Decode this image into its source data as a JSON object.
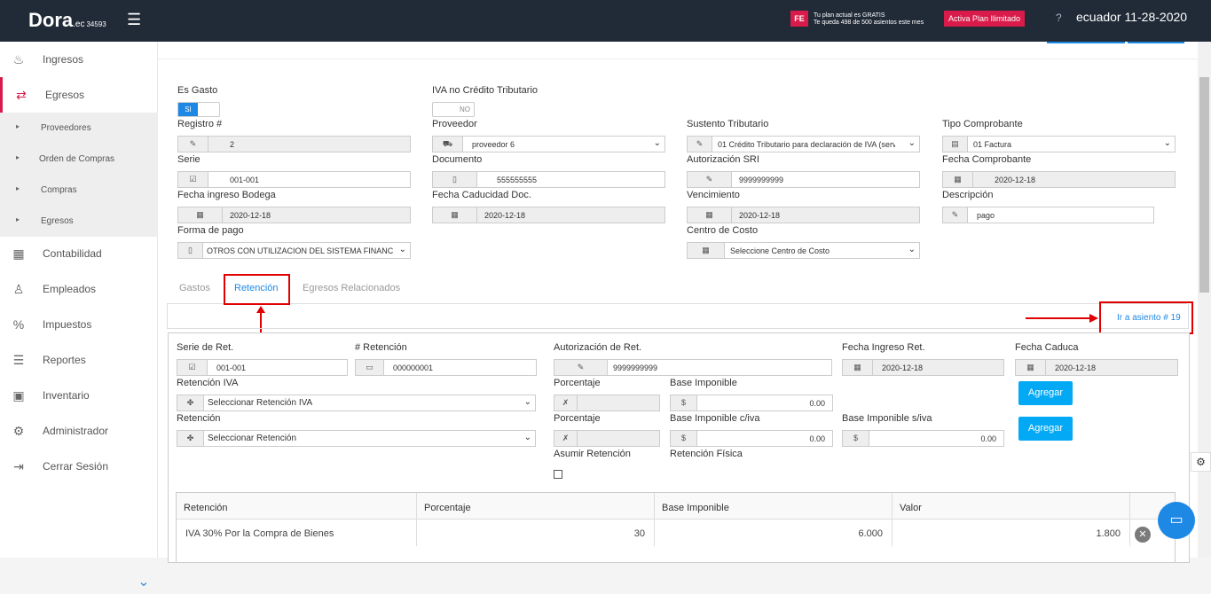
{
  "topbar": {
    "logo": "Dora",
    "logo_ec": ".ec",
    "logo_num": "34593",
    "fe": "FE",
    "plan_line1": "Tu plan actual es GRATIS",
    "plan_line2": "Te queda 498 de 500 asientos este mes",
    "activa": "Activa Plan Ilimitado",
    "user_date": "ecuador 11-28-2020"
  },
  "sidebar": {
    "items": [
      {
        "label": "Ingresos",
        "icon": "piggy-icon"
      },
      {
        "label": "Egresos",
        "icon": "money-out-icon"
      },
      {
        "label": "Contabilidad",
        "icon": "calculator-icon"
      },
      {
        "label": "Empleados",
        "icon": "people-icon"
      },
      {
        "label": "Impuestos",
        "icon": "tax-icon"
      },
      {
        "label": "Reportes",
        "icon": "report-icon"
      },
      {
        "label": "Inventario",
        "icon": "boxes-icon"
      },
      {
        "label": "Administrador",
        "icon": "gear-icon"
      },
      {
        "label": "Cerrar Sesión",
        "icon": "logout-icon"
      }
    ],
    "sub_items": [
      "Proveedores",
      "Orden de Compras",
      "Compras",
      "Egresos"
    ]
  },
  "form": {
    "es_gasto": "Es Gasto",
    "es_gasto_value": "SI",
    "iva_no_credito": "IVA no Crédito Tributario",
    "iva_no_credito_value": "NO",
    "registro_label": "Registro #",
    "registro_value": "2",
    "proveedor_label": "Proveedor",
    "proveedor_value": "proveedor 6",
    "sustento_label": "Sustento Tributario",
    "sustento_value": "01 Crédito Tributario para declaración de IVA (serv",
    "tipo_label": "Tipo Comprobante",
    "tipo_value": "01 Factura",
    "serie_label": "Serie",
    "serie_value": "001-001",
    "documento_label": "Documento",
    "documento_value": "555555555",
    "autorizacion_label": "Autorización SRI",
    "autorizacion_value": "9999999999",
    "fecha_comp_label": "Fecha Comprobante",
    "fecha_comp_value": "2020-12-18",
    "fecha_bodega_label": "Fecha ingreso Bodega",
    "fecha_bodega_value": "2020-12-18",
    "fecha_caducidad_label": "Fecha Caducidad Doc.",
    "fecha_caducidad_value": "2020-12-18",
    "vencimiento_label": "Vencimiento",
    "vencimiento_value": "2020-12-18",
    "descripcion_label": "Descripción",
    "descripcion_value": "pago",
    "forma_pago_label": "Forma de pago",
    "forma_pago_value": "OTROS CON UTILIZACION DEL SISTEMA FINANC",
    "centro_costo_label": "Centro de Costo",
    "centro_costo_value": "Seleccione Centro de Costo"
  },
  "tabs": [
    "Gastos",
    "Retención",
    "Egresos Relacionados"
  ],
  "ir_asiento": "Ir a asiento # 19",
  "retencion": {
    "serie_label": "Serie de Ret.",
    "serie_value": "001-001",
    "num_label": "# Retención",
    "num_value": "000000001",
    "autorizacion_label": "Autorización de Ret.",
    "autorizacion_value": "9999999999",
    "fecha_ingreso_label": "Fecha Ingreso Ret.",
    "fecha_ingreso_value": "2020-12-18",
    "fecha_caduca_label": "Fecha Caduca",
    "fecha_caduca_value": "2020-12-18",
    "ret_iva_label": "Retención IVA",
    "ret_iva_value": "Seleccionar Retención IVA",
    "porcentaje_label": "Porcentaje",
    "base_label": "Base Imponible",
    "base_value": "0.00",
    "agregar": "Agregar",
    "ret_label": "Retención",
    "ret_value": "Seleccionar Retención",
    "porcentaje2_label": "Porcentaje",
    "base_civa_label": "Base Imponible c/iva",
    "base_civa_value": "0.00",
    "base_siva_label": "Base Imponible s/iva",
    "base_siva_value": "0.00",
    "asumir_label": "Asumir Retención",
    "fisica_label": "Retención Física",
    "currency": "$"
  },
  "table": {
    "headers": [
      "Retención",
      "Porcentaje",
      "Base Imponible",
      "Valor"
    ],
    "rows": [
      {
        "retencion": "IVA 30% Por la Compra de Bienes",
        "porcentaje": "30",
        "base": "6.000",
        "valor": "1.800"
      }
    ]
  }
}
